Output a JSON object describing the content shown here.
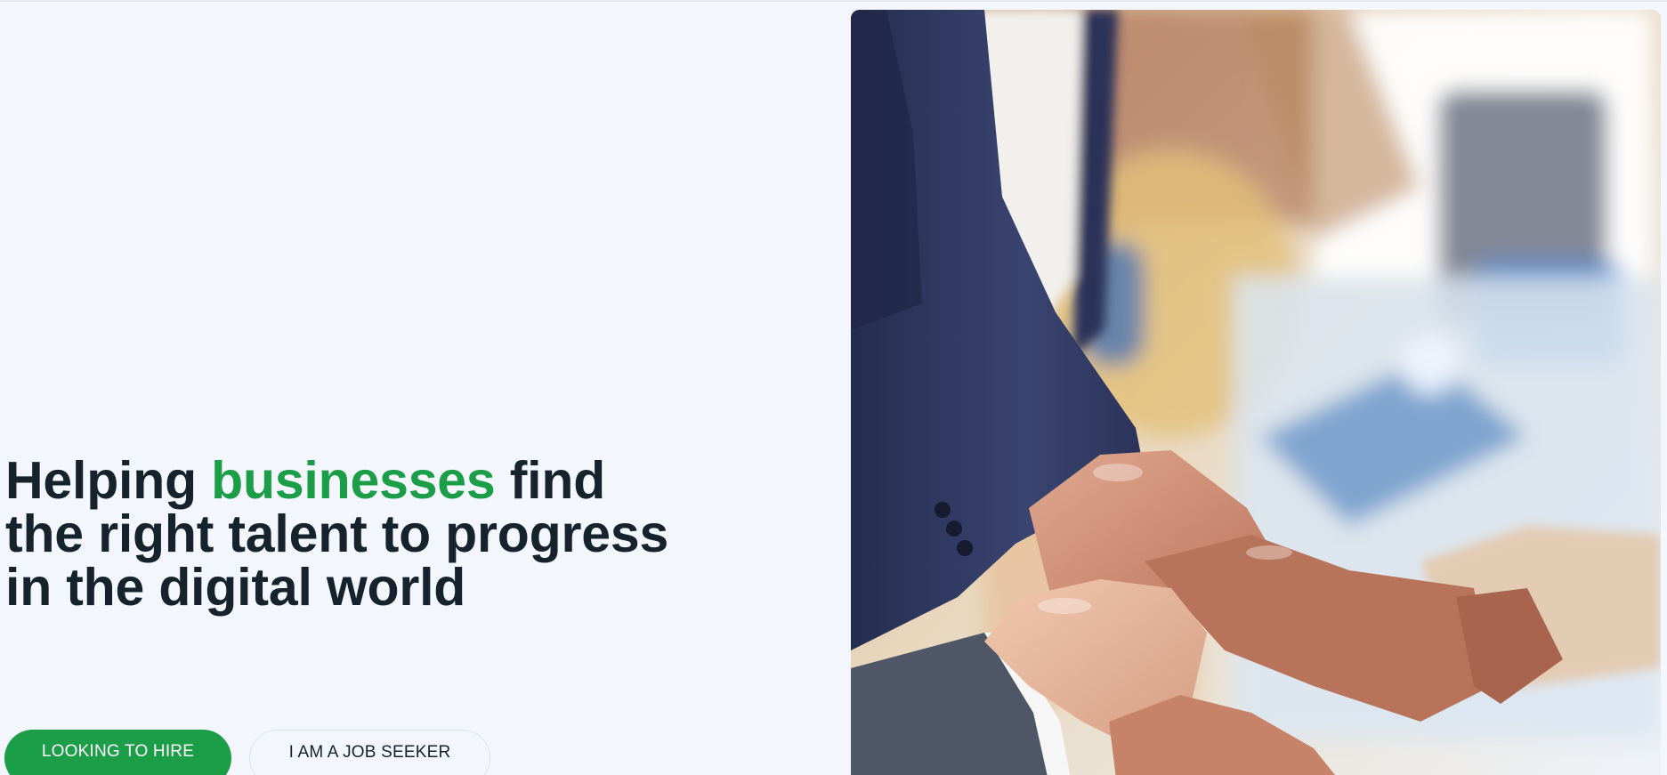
{
  "hero": {
    "headline_start": "Helping",
    "headline_highlight": "businesses",
    "headline_end": "find the right talent to progress in the digital world",
    "primary_button": "LOOKING TO HIRE",
    "secondary_button": "I AM A JOB SEEKER",
    "image_icon": "team-hands-photo"
  },
  "colors": {
    "accent_green": "#1c9d48",
    "heading_dark": "#17232c",
    "page_background": "#f3f7fd"
  }
}
